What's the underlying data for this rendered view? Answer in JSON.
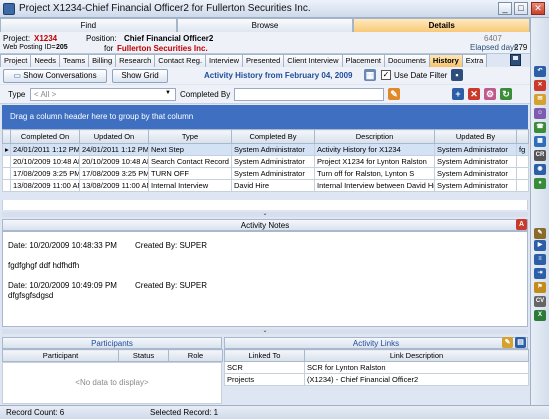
{
  "window": {
    "title": "Project X1234-Chief Financial Officer2 for Fullerton Securities Inc.",
    "min": "_",
    "max": "□",
    "close": "✕"
  },
  "top_tabs": [
    {
      "label": "Find"
    },
    {
      "label": "Browse"
    },
    {
      "label": "Details"
    }
  ],
  "header": {
    "project_label": "Project:",
    "project_value": "X1234",
    "web_posting_label": "Web Posting ID=",
    "web_posting_value": "205",
    "position_label": "Position:",
    "position_value": "Chief Financial Officer2",
    "for_label": "for",
    "company_value": "Fullerton Securities Inc.",
    "record_no": "6407",
    "elapsed_label": "Elapsed days",
    "elapsed_value": "279"
  },
  "sub_tabs": [
    {
      "label": "Project"
    },
    {
      "label": "Needs"
    },
    {
      "label": "Teams"
    },
    {
      "label": "Billing"
    },
    {
      "label": "Research"
    },
    {
      "label": "Contact Reg."
    },
    {
      "label": "Interview"
    },
    {
      "label": "Presented"
    },
    {
      "label": "Client Interview"
    },
    {
      "label": "Placement"
    },
    {
      "label": "Documents"
    },
    {
      "label": "History"
    },
    {
      "label": "Extra"
    }
  ],
  "toolbar": {
    "show_conversations": "Show Conversations",
    "show_grid": "Show Grid",
    "activity_title": "Activity History from  February 04, 2009",
    "use_date_filter": "Use Date Filter"
  },
  "filter": {
    "type_label": "Type",
    "type_value": "< All >",
    "completed_by_label": "Completed By",
    "completed_by_value": ""
  },
  "grid": {
    "group_hint": "Drag a column header here to group by that column",
    "columns": [
      "Completed On",
      "Updated On",
      "Type",
      "Completed By",
      "Description",
      "Updated By"
    ],
    "rows": [
      {
        "completed_on": "24/01/2011 1:12 PM",
        "updated_on": "24/01/2011 1:12 PM",
        "type": "Next Step",
        "completed_by": "System Administrator",
        "description": "Activity History for X1234",
        "updated_by": "System Administrator",
        "extra": "fg"
      },
      {
        "completed_on": "20/10/2009 10:48 AM",
        "updated_on": "20/10/2009 10:48 AM",
        "type": "Search Contact Record",
        "completed_by": "System Administrator",
        "description": "Project X1234 for Lynton Ralston",
        "updated_by": "System Administrator",
        "extra": ""
      },
      {
        "completed_on": "17/08/2009 3:25 PM",
        "updated_on": "17/08/2009 3:25 PM",
        "type": "TURN OFF",
        "completed_by": "System Administrator",
        "description": "Turn off for Ralston, Lynton S",
        "updated_by": "System Administrator",
        "extra": ""
      },
      {
        "completed_on": "13/08/2009 11:00 AM",
        "updated_on": "13/08/2009 11:00 AM",
        "type": "Internal Interview",
        "completed_by": "David Hire",
        "description": "Internal Interview between David Hire and",
        "updated_by": "System Administrator",
        "extra": ""
      }
    ]
  },
  "notes": {
    "header": "Activity Notes",
    "entries": [
      {
        "date_line": "Date: 10/20/2009 10:48:33 PM",
        "created_by": "Created By: SUPER",
        "body": "fgdfghgf ddf hdfhdfh"
      },
      {
        "date_line": "Date: 10/20/2009 10:49:09 PM",
        "created_by": "Created By: SUPER",
        "body": "dfgfsgfsdgsd"
      }
    ]
  },
  "participants": {
    "header": "Participants",
    "columns": [
      "Participant",
      "Status",
      "Role"
    ],
    "empty_text": "<No data to display>"
  },
  "activity_links": {
    "header": "Activity Links",
    "columns": [
      "Linked To",
      "Link Description"
    ],
    "rows": [
      {
        "linked_to": "SCR",
        "description": "SCR for Lynton Ralston"
      },
      {
        "linked_to": "Projects",
        "description": "(X1234) - Chief Financial Officer2"
      }
    ]
  },
  "status": {
    "record_count": "Record Count: 6",
    "selected_record": "Selected Record: 1"
  },
  "colors": {
    "accent": "#3f6fc0",
    "red_text": "#c00000",
    "active_tab": "#f8c978"
  }
}
